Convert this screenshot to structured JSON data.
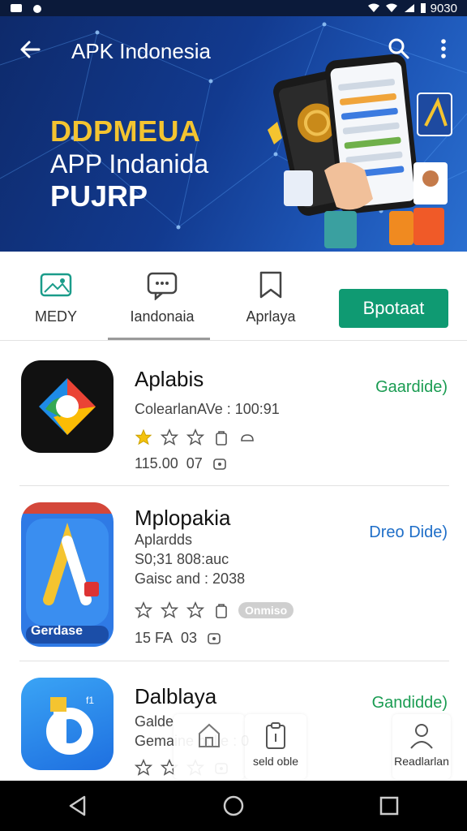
{
  "status_bar": {
    "time": "9030"
  },
  "app_bar": {
    "title": "APK Indonesia"
  },
  "promo": {
    "line1": "DDPMEUA",
    "line2": "APP Indanida",
    "line3": "PUJRP"
  },
  "categories": [
    {
      "label": "MEDY",
      "icon": "image-icon"
    },
    {
      "label": "Iandonaia",
      "icon": "chat-icon"
    },
    {
      "label": "Aprlaya",
      "icon": "bookmark-icon"
    }
  ],
  "update_button": {
    "label": "Bpotaat"
  },
  "apps": [
    {
      "name": "Aplabis",
      "meta1": "ColearlanAVe : 100:91",
      "price": "115.00",
      "count": "07",
      "link": "Gaardide)",
      "link_color": "#1a9c52",
      "rating": 1
    },
    {
      "name": "Mplopakia",
      "meta1": "Aplardds",
      "meta2": "S0;31 808:auc",
      "meta3": "Gaisc and : 2038",
      "price": "15 FA",
      "count": "03",
      "link": "Dreo Dide)",
      "link_color": "#1e6ec8",
      "badge": "Onmiso",
      "icon_label": "Gerdase",
      "rating": 0
    },
    {
      "name": "Dalblaya",
      "meta1": "Galde",
      "meta2": "Gemaine nulle : 0",
      "link": "Gandidde)",
      "link_color": "#1a9c52",
      "rating": 0
    }
  ],
  "bottom_cards": [
    {
      "label": "",
      "icon": "home-icon"
    },
    {
      "label": "seld oble",
      "icon": "clipboard-icon"
    },
    {
      "label": "Readlarlan",
      "icon": "profile-icon"
    }
  ],
  "colors": {
    "accent": "#0f9a72",
    "header": "#123a8f",
    "promo_yellow": "#f4c430"
  }
}
